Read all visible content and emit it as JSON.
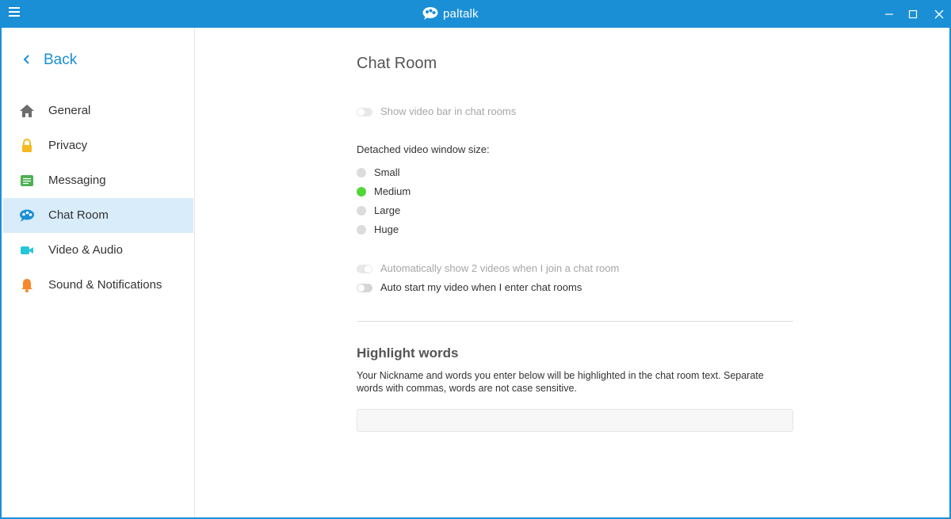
{
  "app": {
    "logo_text": "paltalk",
    "brand_color": "#1a8fd6"
  },
  "titlebar": {
    "minimize_icon": "minimize-icon",
    "maximize_icon": "maximize-icon",
    "close_icon": "close-icon"
  },
  "sidebar": {
    "back_label": "Back",
    "items": [
      {
        "label": "General",
        "icon": "home-icon",
        "active": false
      },
      {
        "label": "Privacy",
        "icon": "lock-icon",
        "active": false
      },
      {
        "label": "Messaging",
        "icon": "message-icon",
        "active": false
      },
      {
        "label": "Chat Room",
        "icon": "chat-room-icon",
        "active": true
      },
      {
        "label": "Video & Audio",
        "icon": "video-icon",
        "active": false
      },
      {
        "label": "Sound & Notifications",
        "icon": "bell-icon",
        "active": false
      }
    ]
  },
  "main": {
    "title": "Chat Room",
    "show_video_bar": {
      "label": "Show video bar in chat rooms",
      "enabled": false,
      "on": false
    },
    "detached_size": {
      "label": "Detached video window size:",
      "options": [
        "Small",
        "Medium",
        "Large",
        "Huge"
      ],
      "selected": "Medium"
    },
    "auto_show_two": {
      "label": "Automatically show 2 videos when I join a chat room",
      "enabled": false,
      "on": false
    },
    "auto_start_video": {
      "label": "Auto start my video when I enter chat rooms",
      "enabled": true,
      "on": false
    },
    "highlight": {
      "title": "Highlight words",
      "description": "Your Nickname and words you enter below will be highlighted in the chat room text. Separate words with commas, words are not case sensitive.",
      "value": ""
    }
  }
}
